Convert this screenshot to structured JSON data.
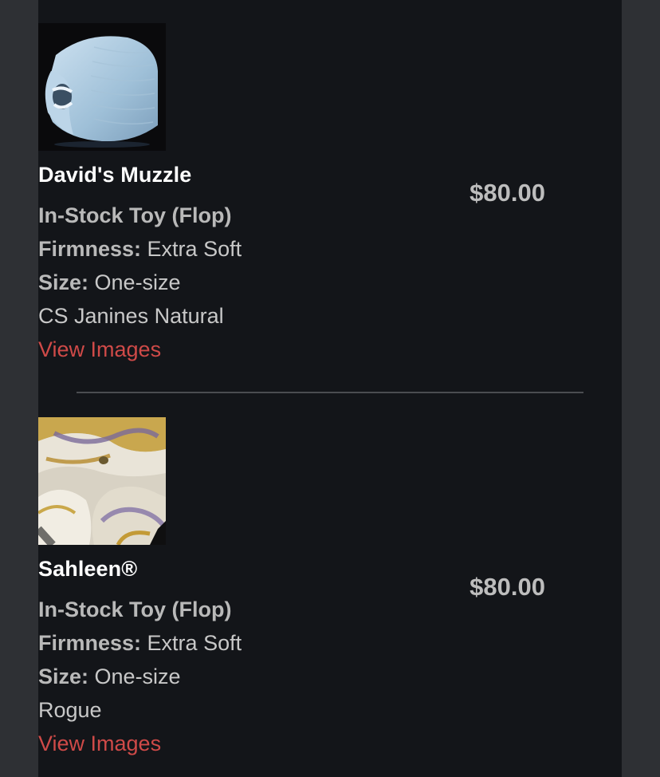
{
  "cart": {
    "items": [
      {
        "name": "David's Muzzle",
        "price": "$80.00",
        "type": "In-Stock Toy (Flop)",
        "firmness_label": "Firmness:",
        "firmness_value": " Extra Soft",
        "size_label": "Size:",
        "size_value": " One-size",
        "color": "CS Janines Natural",
        "link_label": "View Images",
        "image_icon": "blue-muzzle-toy-photo"
      },
      {
        "name": "Sahleen®",
        "price": "$80.00",
        "type": "In-Stock Toy (Flop)",
        "firmness_label": "Firmness:",
        "firmness_value": " Extra Soft",
        "size_label": "Size:",
        "size_value": " One-size",
        "color": "Rogue",
        "link_label": "View Images",
        "image_icon": "marbled-toy-photo"
      }
    ]
  },
  "colors": {
    "background": "#2e3034",
    "panel": "#131519",
    "link": "#cf4a48",
    "title": "#ffffff",
    "muted_text": "#c8c8c8"
  }
}
